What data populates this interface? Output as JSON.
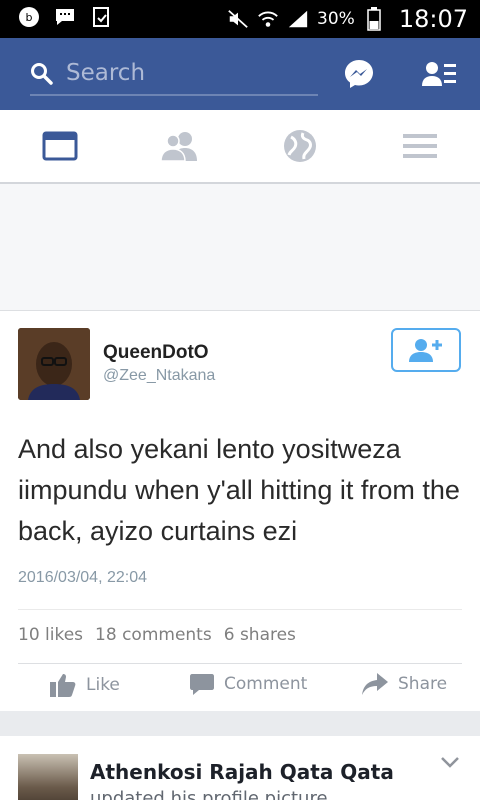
{
  "status_bar": {
    "battery_percent": "30%",
    "time": "18:07"
  },
  "header": {
    "search_placeholder": "Search"
  },
  "nav": {
    "tabs": [
      {
        "icon": "news-feed-icon",
        "active": true
      },
      {
        "icon": "friends-icon",
        "active": false
      },
      {
        "icon": "globe-icon",
        "active": false
      },
      {
        "icon": "menu-icon",
        "active": false
      }
    ]
  },
  "post": {
    "tweet": {
      "name": "QueenDotO",
      "handle": "@Zee_Ntakana",
      "text": "And also yekani lento yositweza iimpundu when y'all hitting it from the back, ayizo curtains ezi",
      "date": "2016/03/04, 22:04"
    },
    "stats": {
      "likes": "10 likes",
      "comments": "18 comments",
      "shares": "6 shares"
    },
    "actions": {
      "like": "Like",
      "comment": "Comment",
      "share": "Share"
    }
  },
  "next_story": {
    "name": "Athenkosi Rajah Qata Qata",
    "subtitle": "updated his profile picture."
  },
  "colors": {
    "brand_blue": "#3b5998",
    "twitter_blue": "#55acee"
  }
}
